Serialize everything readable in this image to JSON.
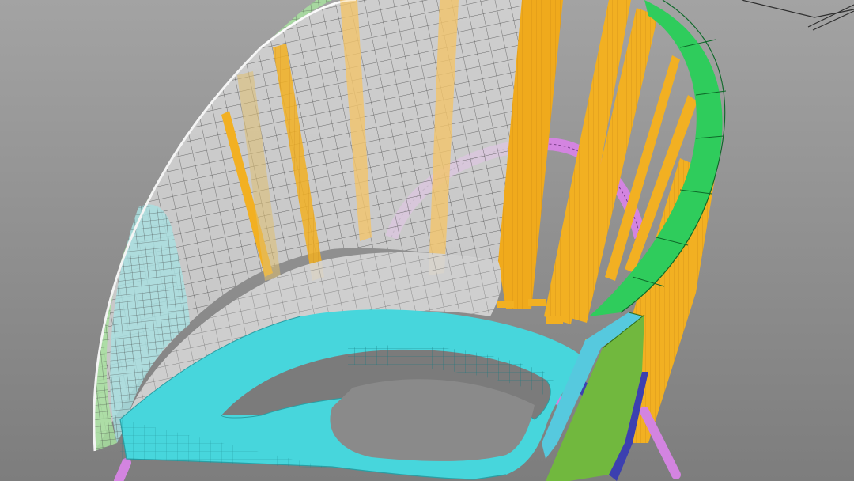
{
  "viewport": {
    "background": {
      "top": "#a3a3a3",
      "bottom": "#7d7d7d"
    },
    "grid_visible": false
  },
  "model": {
    "object_colors": {
      "shell_wire": "#ececec",
      "shell_fill": "#d9d9d9",
      "edge_band_green": "#a8e0a0",
      "edge_band_cyan": "#a9dfe0",
      "slats_orange": "#f2b022",
      "arm_green": "#2fcc5c",
      "seat_frame_cyan": "#47d6dc",
      "frame_purple": "#d384e0",
      "seat_ring_navy": "#3c40b0",
      "leg_green": "#71b83e"
    },
    "parts": [
      "shell-mesh",
      "back-slats",
      "right-arm-band",
      "seat-frame",
      "seat-cushion",
      "support-ring",
      "legs",
      "side-panel"
    ]
  }
}
